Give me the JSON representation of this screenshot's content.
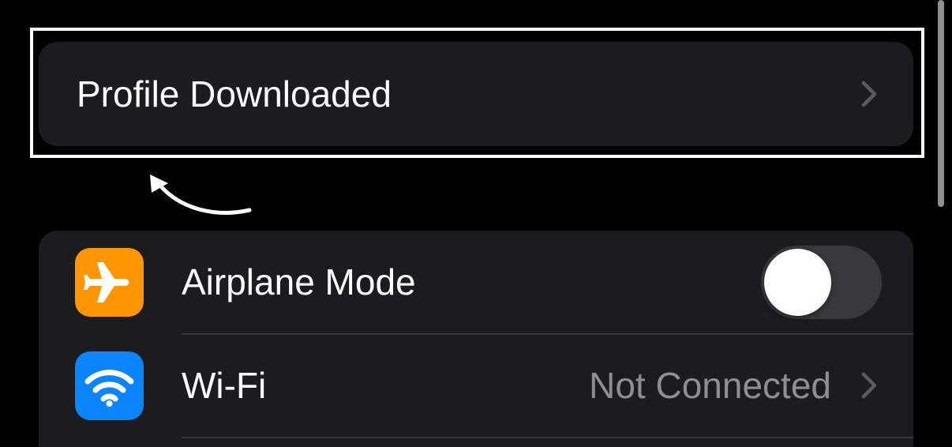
{
  "profile_banner": {
    "label": "Profile Downloaded",
    "chevron_icon": "chevron-right-icon"
  },
  "annotation": {
    "arrow_icon": "curved-arrow-icon",
    "highlight_color": "#ffffff"
  },
  "settings": {
    "rows": [
      {
        "label": "Airplane Mode",
        "icon": "airplane-icon",
        "icon_color": "#ff9500",
        "control": "toggle",
        "toggle_on": false
      },
      {
        "label": "Wi-Fi",
        "icon": "wifi-icon",
        "icon_color": "#0a84ff",
        "value": "Not Connected",
        "chevron_icon": "chevron-right-icon"
      }
    ]
  },
  "colors": {
    "background": "#000000",
    "cell_background": "#1c1c1e",
    "secondary_text": "#8e8e93",
    "toggle_off_track": "#39393d"
  }
}
